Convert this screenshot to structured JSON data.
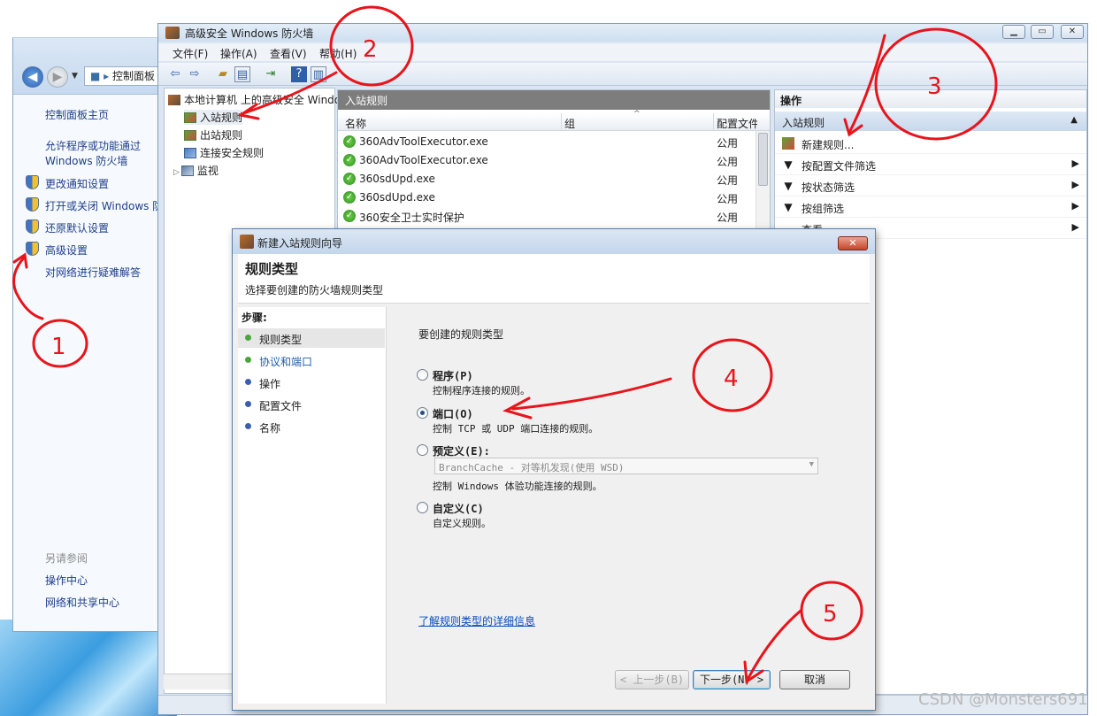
{
  "control_panel": {
    "breadcrumb": "控制面板",
    "links": [
      "控制面板主页",
      "允许程序或功能通过 Windows 防火墙",
      "更改通知设置",
      "打开或关闭 Windows 防火墙",
      "还原默认设置",
      "高级设置",
      "对网络进行疑难解答"
    ],
    "see_also_title": "另请参阅",
    "see_also": [
      "操作中心",
      "网络和共享中心"
    ]
  },
  "firewall": {
    "title": "高级安全 Windows 防火墙",
    "menu": [
      "文件(F)",
      "操作(A)",
      "查看(V)",
      "帮助(H)"
    ],
    "tree": {
      "root": "本地计算机 上的高级安全 Windows",
      "items": [
        "入站规则",
        "出站规则",
        "连接安全规则",
        "监视"
      ]
    },
    "center": {
      "header": "入站规则",
      "columns": [
        "名称",
        "组",
        "配置文件"
      ],
      "rows": [
        {
          "name": "360AdvToolExecutor.exe",
          "profile": "公用"
        },
        {
          "name": "360AdvToolExecutor.exe",
          "profile": "公用"
        },
        {
          "name": "360sdUpd.exe",
          "profile": "公用"
        },
        {
          "name": "360sdUpd.exe",
          "profile": "公用"
        },
        {
          "name": "360安全卫士实时保护",
          "profile": "公用"
        }
      ]
    },
    "actions": {
      "header": "操作",
      "section": "入站规则",
      "items": [
        "新建规则...",
        "按配置文件筛选",
        "按状态筛选",
        "按组筛选",
        "查看"
      ]
    }
  },
  "wizard": {
    "title": "新建入站规则向导",
    "heading": "规则类型",
    "subheading": "选择要创建的防火墙规则类型",
    "steps_title": "步骤:",
    "steps": [
      "规则类型",
      "协议和端口",
      "操作",
      "配置文件",
      "名称"
    ],
    "prompt": "要创建的规则类型",
    "options": [
      {
        "label": "程序(P)",
        "desc": "控制程序连接的规则。",
        "selected": false
      },
      {
        "label": "端口(O)",
        "desc": "控制 TCP 或 UDP 端口连接的规则。",
        "selected": true
      },
      {
        "label": "预定义(E):",
        "desc": "控制 Windows 体验功能连接的规则。",
        "selected": false
      },
      {
        "label": "自定义(C)",
        "desc": "自定义规则。",
        "selected": false
      }
    ],
    "predefined_value": "BranchCache - 对等机发现(使用 WSD)",
    "learn_more": "了解规则类型的详细信息",
    "buttons": {
      "back": "< 上一步(B)",
      "next": "下一步(N) >",
      "cancel": "取消"
    }
  },
  "annotations": [
    "1",
    "2",
    "3",
    "4",
    "5"
  ],
  "watermark": "CSDN @Monsters691",
  "colors": {
    "annotation": "#e8141b",
    "link": "#1f3d8c",
    "accent": "#3c7fb1"
  }
}
